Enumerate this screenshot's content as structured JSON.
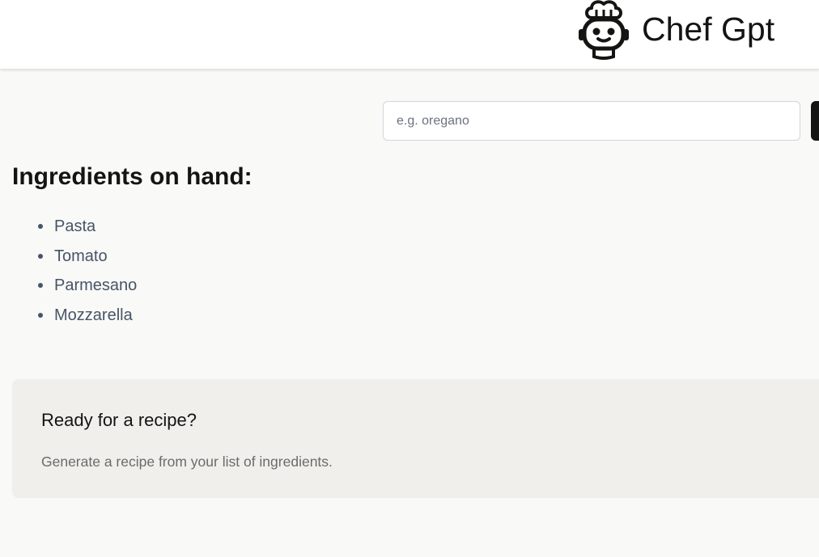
{
  "header": {
    "brand_title": "Chef Gpt",
    "logo_icon": "chef-robot-icon"
  },
  "input": {
    "placeholder": "e.g. oregano",
    "value": ""
  },
  "add_button": {
    "icon": "add-button",
    "color": "#141413"
  },
  "ingredients": {
    "heading": "Ingredients on hand:",
    "items": [
      {
        "label": "Pasta"
      },
      {
        "label": "Tomato"
      },
      {
        "label": "Parmesano"
      },
      {
        "label": "Mozzarella"
      }
    ]
  },
  "recipe_panel": {
    "title": "Ready for a recipe?",
    "description": "Generate a recipe from your list of ingredients."
  },
  "colors": {
    "background": "#f9f9f7",
    "header": "#ffffff",
    "panel": "#f0efeb",
    "text_primary": "#141413",
    "text_list": "#475467",
    "text_muted": "#6b6b6b"
  }
}
